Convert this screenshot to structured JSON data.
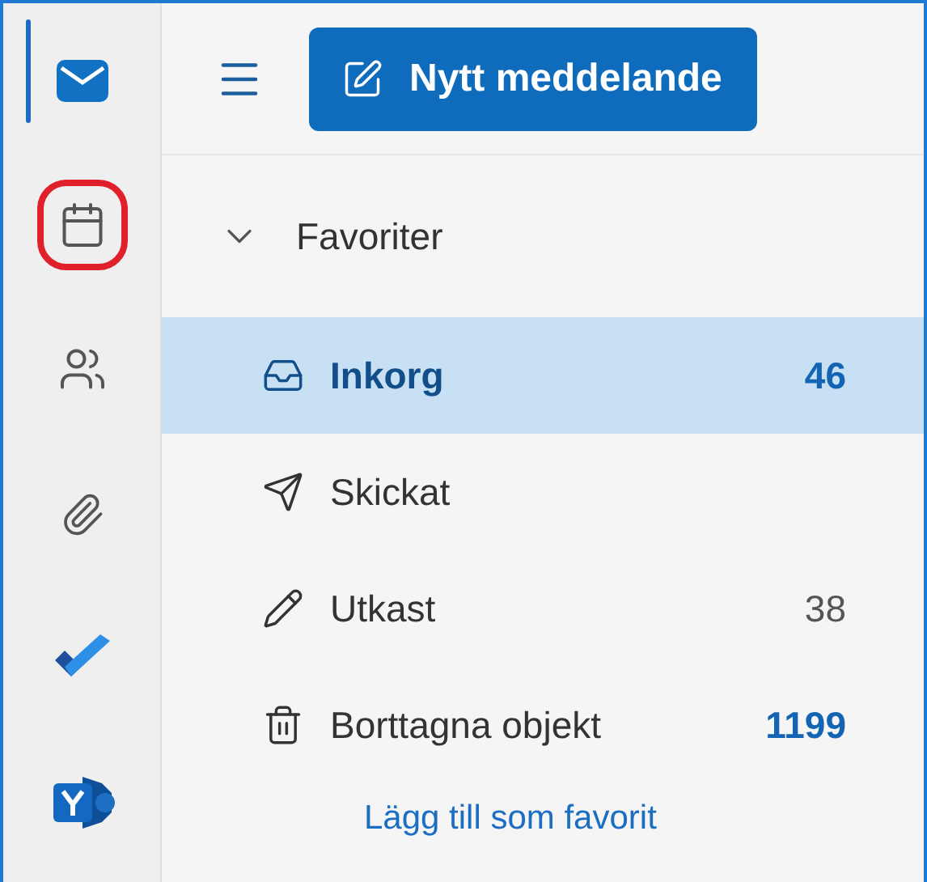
{
  "app_rail": [
    {
      "selected": true,
      "highlighted": false
    },
    {
      "selected": false,
      "highlighted": true
    },
    {
      "selected": false,
      "highlighted": false
    },
    {
      "selected": false,
      "highlighted": false
    },
    {
      "selected": false,
      "highlighted": false
    },
    {
      "selected": false,
      "highlighted": false
    }
  ],
  "new_message_button": {
    "label": "Nytt meddelande"
  },
  "favorites": {
    "title": "Favoriter",
    "expanded": true,
    "folders": [
      {
        "name": "Inkorg",
        "count": "46",
        "unread": true,
        "selected": true
      },
      {
        "name": "Skickat",
        "selected": false
      },
      {
        "name": "Utkast",
        "count": "38",
        "unread": false,
        "selected": false
      },
      {
        "name": "Borttagna objekt",
        "count": "1199",
        "unread": true,
        "selected": false
      }
    ],
    "add_link": "Lägg till som favorit"
  }
}
